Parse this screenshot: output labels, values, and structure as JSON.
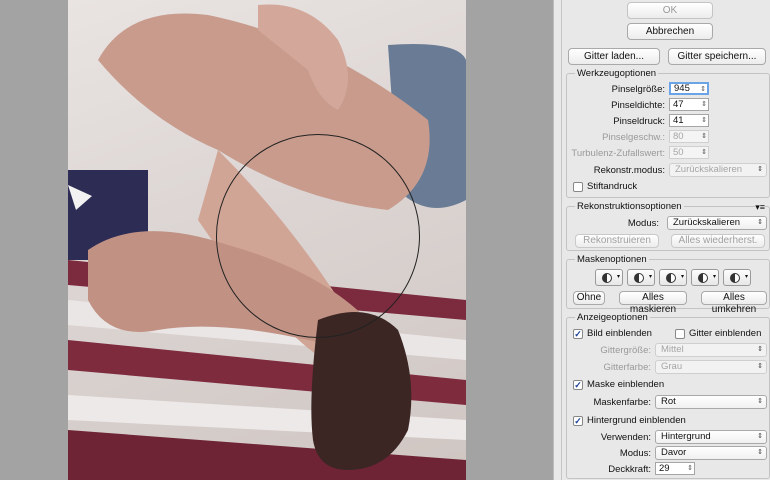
{
  "buttons": {
    "ok": "OK",
    "cancel": "Abbrechen",
    "load_mesh": "Gitter laden...",
    "save_mesh": "Gitter speichern..."
  },
  "tool_options": {
    "title": "Werkzeugoptionen",
    "brush_size_label": "Pinselgröße:",
    "brush_size": "945",
    "brush_density_label": "Pinseldichte:",
    "brush_density": "47",
    "brush_pressure_label": "Pinseldruck:",
    "brush_pressure": "41",
    "brush_rate_label": "Pinselgeschw.:",
    "brush_rate": "80",
    "turbulence_label": "Turbulenz-Zufallswert:",
    "turbulence": "50",
    "reconstruct_mode_label": "Rekonstr.modus:",
    "reconstruct_mode": "Zurückskalieren",
    "stylus_pressure_label": "Stiftandruck"
  },
  "reconstruct_options": {
    "title": "Rekonstruktionsoptionen",
    "mode_label": "Modus:",
    "mode": "Zurückskalieren",
    "reconstruct_button": "Rekonstruieren",
    "restore_all_button": "Alles wiederherst."
  },
  "mask_options": {
    "title": "Maskenoptionen",
    "none_button": "Ohne",
    "mask_all_button": "Alles maskieren",
    "invert_all_button": "Alles umkehren"
  },
  "view_options": {
    "title": "Anzeigeoptionen",
    "show_image_label": "Bild einblenden",
    "show_mesh_label": "Gitter einblenden",
    "mesh_size_label": "Gittergröße:",
    "mesh_size": "Mittel",
    "mesh_color_label": "Gitterfarbe:",
    "mesh_color": "Grau",
    "show_mask_label": "Maske einblenden",
    "mask_color_label": "Maskenfarbe:",
    "mask_color": "Rot",
    "show_backdrop_label": "Hintergrund einblenden",
    "use_label": "Verwenden:",
    "use": "Hintergrund",
    "mode_label": "Modus:",
    "mode": "Davor",
    "opacity_label": "Deckkraft:",
    "opacity": "29"
  },
  "icons": {
    "check": "checkmark-icon",
    "stepper": "stepper-icon",
    "dropdown": "dropdown-arrow-icon",
    "mask": "mask-icon",
    "menu": "panel-menu-icon"
  },
  "colors": {
    "focus": "#6aa3e6",
    "panel": "#e8e8e8",
    "canvas": "#a3a3a3",
    "mask_red": "#c0392b"
  }
}
